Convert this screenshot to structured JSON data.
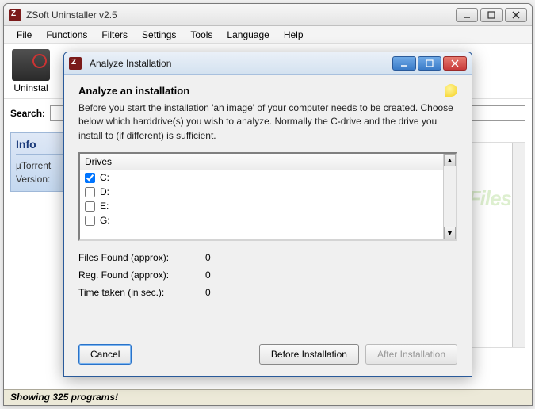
{
  "main_window": {
    "title": "ZSoft Uninstaller v2.5",
    "menu": [
      "File",
      "Functions",
      "Filters",
      "Settings",
      "Tools",
      "Language",
      "Help"
    ],
    "toolbar": {
      "uninstall_label": "Uninstal"
    },
    "search_label": "Search:",
    "search_value": "",
    "sidebar": {
      "title": "Info",
      "line1": "µTorrent",
      "line2": "Version:"
    },
    "status": "Showing 325 programs!"
  },
  "dialog": {
    "title": "Analyze Installation",
    "heading": "Analyze an installation",
    "description": "Before you start the installation 'an image' of your computer needs to be created. Choose below which harddrive(s) you wish to analyze. Normally the C-drive and the drive you install to (if different) is sufficient.",
    "drives_header": "Drives",
    "drives": [
      {
        "label": "C:",
        "checked": true
      },
      {
        "label": "D:",
        "checked": false
      },
      {
        "label": "E:",
        "checked": false
      },
      {
        "label": "G:",
        "checked": false
      }
    ],
    "stats": {
      "files_label": "Files Found (approx):",
      "files_value": "0",
      "reg_label": "Reg. Found (approx):",
      "reg_value": "0",
      "time_label": "Time taken (in sec.):",
      "time_value": "0"
    },
    "buttons": {
      "cancel": "Cancel",
      "before": "Before Installation",
      "after": "After Installation"
    }
  },
  "watermark": "SnapFiles"
}
